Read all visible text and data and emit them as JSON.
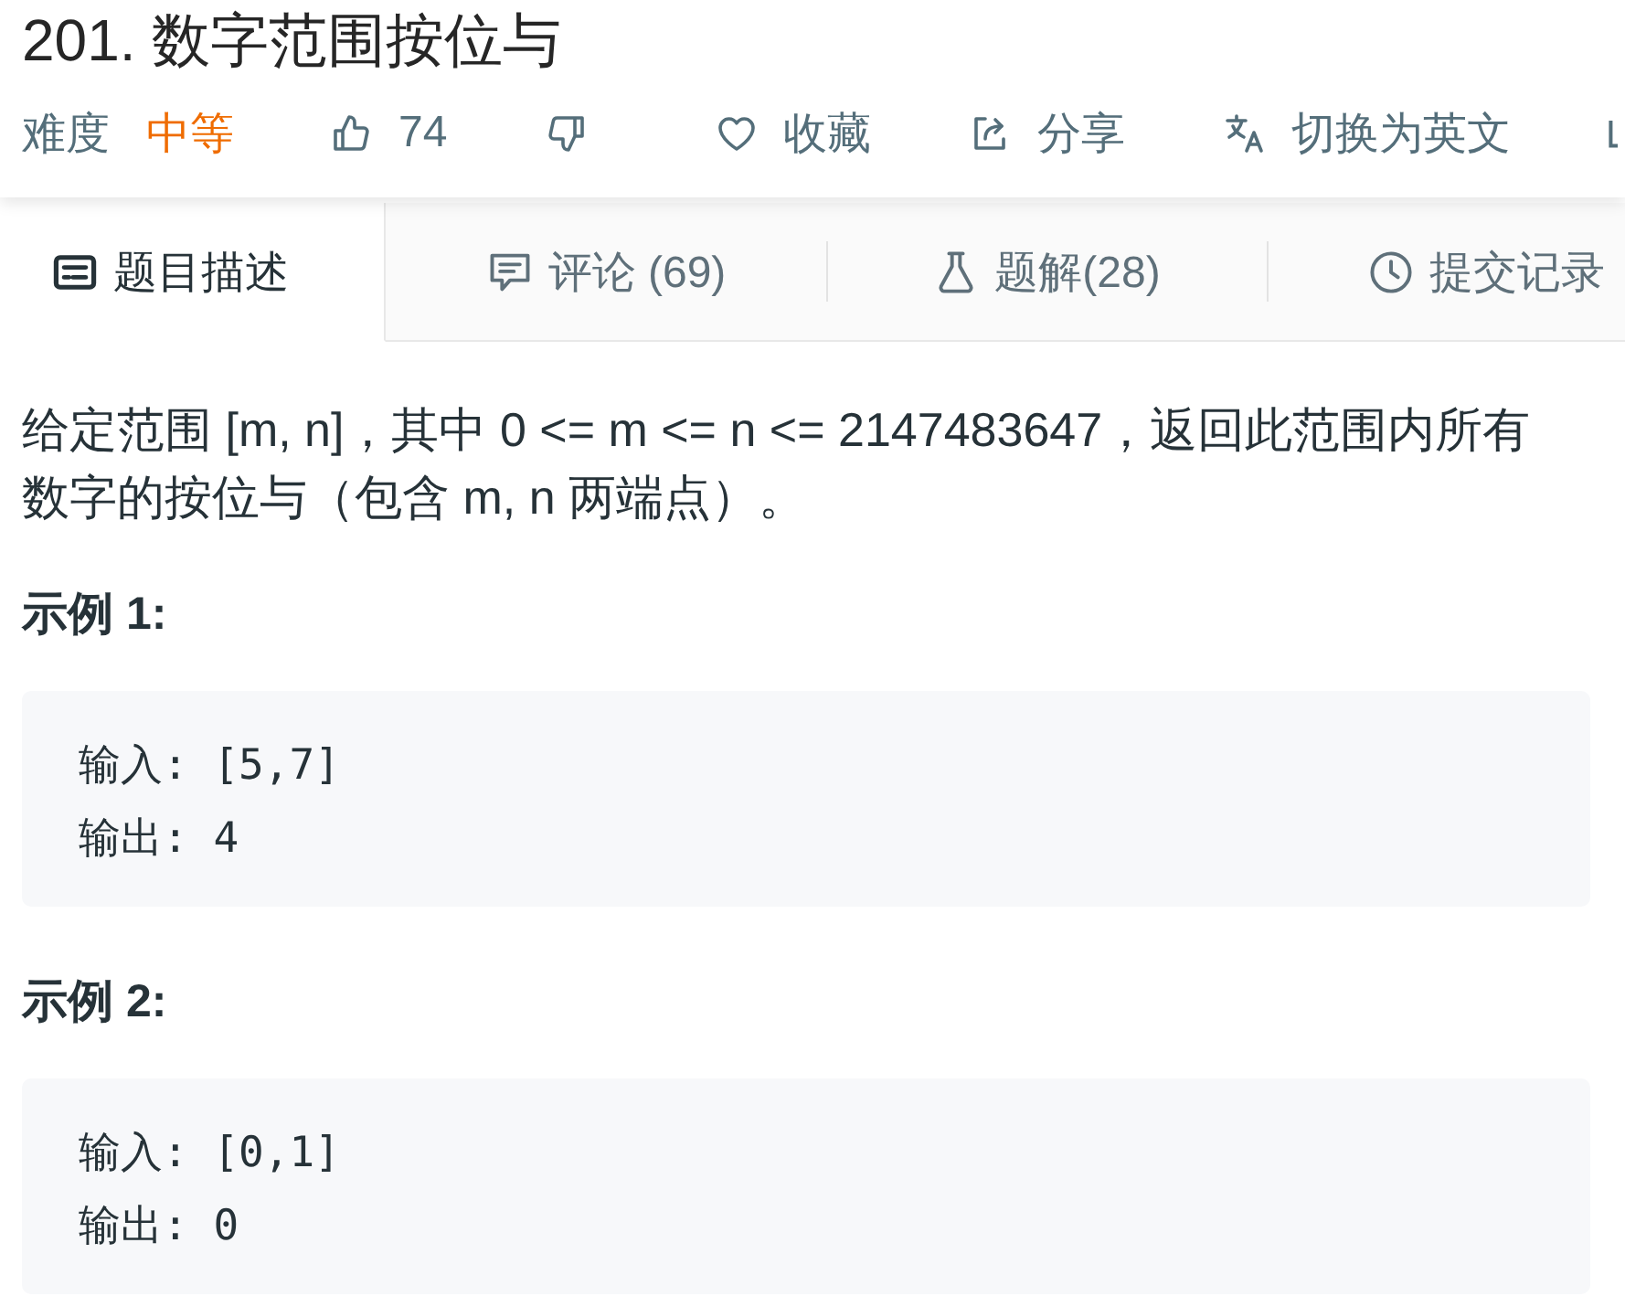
{
  "title": "201. 数字范围按位与",
  "meta": {
    "difficulty_label": "难度",
    "difficulty": {
      "text": "中等",
      "kind": "medium"
    }
  },
  "actions": [
    {
      "kind": "like",
      "label": "74"
    },
    {
      "kind": "dislike"
    },
    {
      "kind": "favorite",
      "label": "收藏"
    },
    {
      "kind": "share",
      "label": "分享"
    },
    {
      "kind": "translate",
      "label": "切换为英文"
    },
    {
      "kind": "partial"
    }
  ],
  "tabs": [
    {
      "kind": "description",
      "label": "题目描述",
      "selected": true
    },
    {
      "kind": "comments",
      "label": "评论 (69)",
      "selected": false
    },
    {
      "kind": "solutions",
      "label": "题解(28)",
      "selected": false
    },
    {
      "kind": "submissions",
      "label": "提交记录",
      "selected": false
    }
  ],
  "description": "给定范围 [m, n]，其中 0 <= m <= n <= 2147483647，返回此范围内所有数字的按位与（包含 m, n 两端点）。",
  "examples": [
    {
      "heading": "示例 1:",
      "lines": [
        "输入: [5,7]",
        "输出: 4"
      ]
    },
    {
      "heading": "示例 2:",
      "lines": [
        "输入: [0,1]",
        "输出: 0"
      ]
    }
  ]
}
